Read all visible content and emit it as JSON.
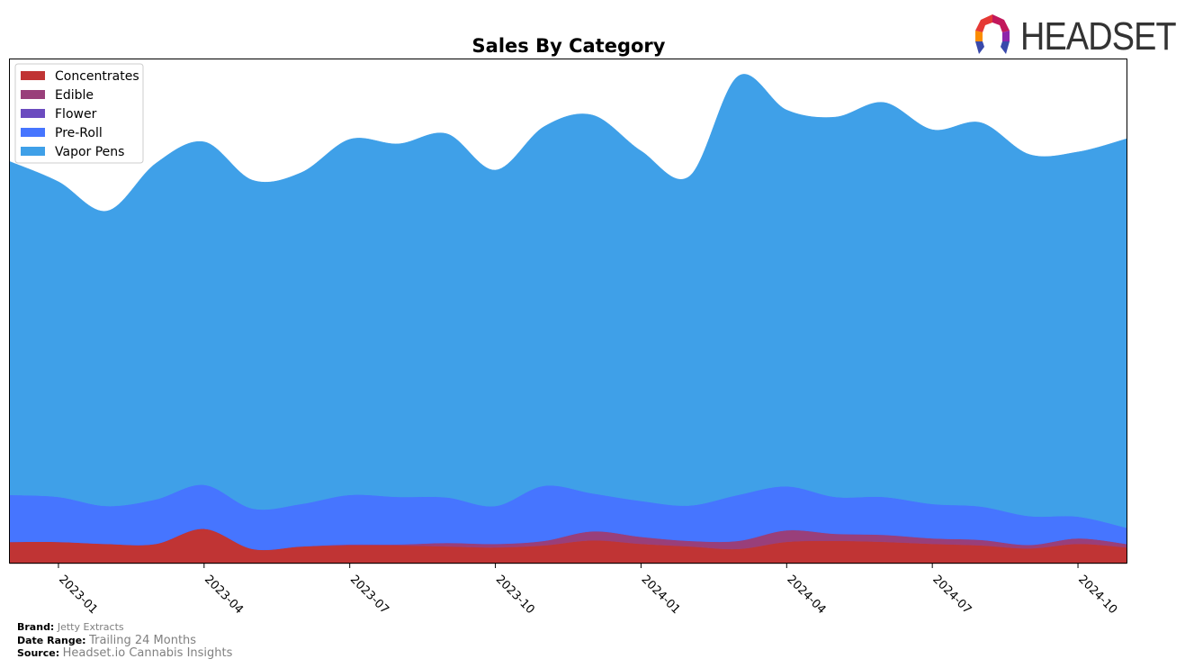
{
  "chart_data": {
    "type": "area",
    "stacked": true,
    "smoothed": true,
    "title": "Sales By Category",
    "xlabel": "",
    "ylabel": "",
    "y_axis_visible": false,
    "grid": false,
    "legend_position": "top-left",
    "x": [
      "2022-12",
      "2023-01",
      "2023-02",
      "2023-03",
      "2023-04",
      "2023-05",
      "2023-06",
      "2023-07",
      "2023-08",
      "2023-09",
      "2023-10",
      "2023-11",
      "2023-12",
      "2024-01",
      "2024-02",
      "2024-03",
      "2024-04",
      "2024-05",
      "2024-06",
      "2024-07",
      "2024-08",
      "2024-09",
      "2024-10",
      "2024-11"
    ],
    "x_ticks": [
      "2023-01",
      "2023-04",
      "2023-07",
      "2023-10",
      "2024-01",
      "2024-04",
      "2024-07",
      "2024-10"
    ],
    "y_units": "relative sales (plot height = 100)",
    "ylim": [
      0,
      100
    ],
    "series": [
      {
        "name": "Concentrates",
        "color": "#c03434",
        "values": [
          4.3,
          4.3,
          3.9,
          3.9,
          6.9,
          2.9,
          3.4,
          3.6,
          3.6,
          3.4,
          3.2,
          3.6,
          4.6,
          3.9,
          3.4,
          2.9,
          4.3,
          4.5,
          4.3,
          3.9,
          3.6,
          3.0,
          3.9,
          3.2
        ]
      },
      {
        "name": "Edible",
        "color": "#993f7a",
        "values": [
          0.0,
          0.0,
          0.0,
          0.0,
          0.0,
          0.0,
          0.0,
          0.2,
          0.2,
          0.7,
          0.7,
          0.9,
          1.8,
          1.4,
          1.1,
          1.6,
          2.3,
          1.4,
          1.4,
          1.1,
          1.1,
          0.7,
          1.1,
          0.7
        ]
      },
      {
        "name": "Flower",
        "color": "#6b4bbf",
        "values": [
          0,
          0,
          0,
          0,
          0,
          0,
          0,
          0,
          0,
          0,
          0,
          0,
          0,
          0,
          0,
          0,
          0,
          0,
          0,
          0,
          0,
          0,
          0,
          0
        ]
      },
      {
        "name": "Pre-Roll",
        "color": "#4675ff",
        "values": [
          9.3,
          8.9,
          7.5,
          8.8,
          8.7,
          8.0,
          8.4,
          9.8,
          9.4,
          9.0,
          7.5,
          10.9,
          7.5,
          7.1,
          7.0,
          9.1,
          8.7,
          7.3,
          7.5,
          6.8,
          6.6,
          5.7,
          4.3,
          3.2
        ]
      },
      {
        "name": "Vapor Pens",
        "color": "#3fa0e8",
        "values": [
          66.0,
          62.4,
          58.4,
          66.5,
          67.9,
          65.0,
          65.6,
          70.4,
          69.9,
          72.0,
          66.5,
          71.1,
          74.9,
          69.3,
          65.2,
          82.9,
          74.5,
          75.2,
          78.1,
          74.1,
          76.0,
          71.6,
          72.2,
          77.0
        ]
      }
    ]
  },
  "logo": {
    "text": "HEADSET"
  },
  "footer": {
    "brand_label": "Brand:",
    "brand_value": "Jetty Extracts",
    "date_label": "Date Range:",
    "date_value": "Trailing 24 Months",
    "source_label": "Source:",
    "source_value": "Headset.io Cannabis Insights"
  }
}
